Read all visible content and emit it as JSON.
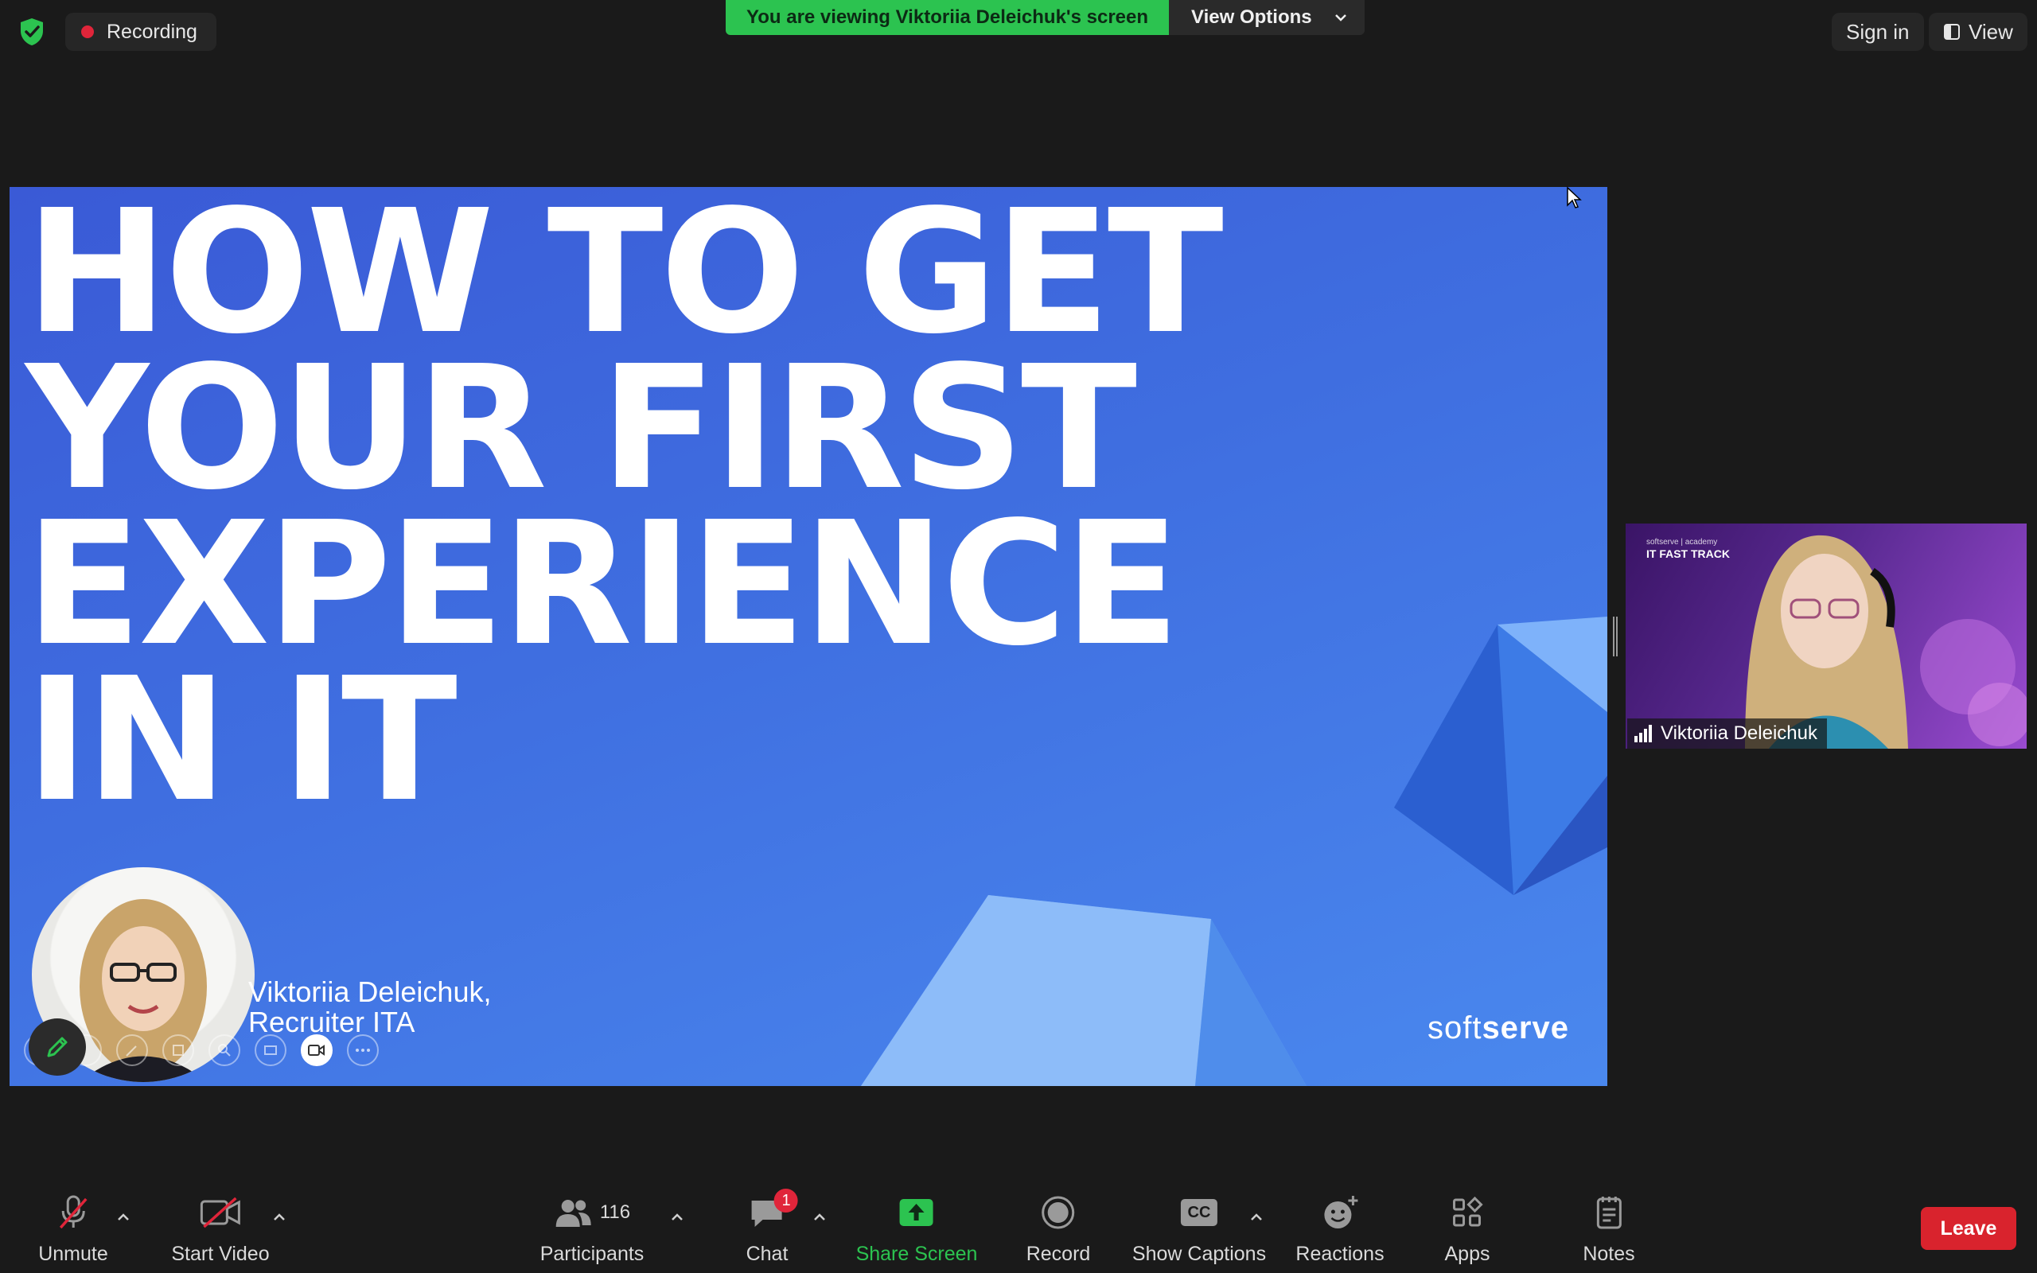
{
  "topbar": {
    "recording_label": "Recording",
    "viewing_banner": "You are viewing Viktoriia Deleichuk's screen",
    "view_options_label": "View Options",
    "sign_in_label": "Sign in",
    "view_label": "View"
  },
  "slide": {
    "title": "HOW TO GET\nYOUR FIRST\nEXPERIENCE\nIN IT",
    "speaker_name": "Viktoriia Deleichuk,",
    "speaker_role": "Recruiter ITA",
    "brand_light": "soft",
    "brand_bold": "serve"
  },
  "video_tile": {
    "participant_name": "Viktoriia Deleichuk",
    "background_logo": "softserve | academy",
    "background_title": "IT FAST TRACK"
  },
  "toolbar": {
    "unmute_label": "Unmute",
    "start_video_label": "Start Video",
    "participants_label": "Participants",
    "participants_count": "116",
    "chat_label": "Chat",
    "chat_badge": "1",
    "share_screen_label": "Share Screen",
    "record_label": "Record",
    "captions_label": "Show Captions",
    "cc_text": "CC",
    "reactions_label": "Reactions",
    "apps_label": "Apps",
    "notes_label": "Notes",
    "leave_label": "Leave"
  },
  "colors": {
    "background": "#1a1a1a",
    "zoom_green": "#2cc350",
    "leave_red": "#d9232d",
    "recording_red": "#e0253a",
    "slide_blue": "#3f6ee0"
  },
  "icons": [
    "shield-check-icon",
    "record-dot-icon",
    "chevron-down-icon",
    "view-icon",
    "pencil-icon",
    "mic-muted-icon",
    "video-off-icon",
    "participants-icon",
    "chat-icon",
    "share-screen-icon",
    "record-icon",
    "cc-icon",
    "reactions-icon",
    "apps-icon",
    "notes-icon",
    "signal-icon",
    "cursor-icon"
  ]
}
